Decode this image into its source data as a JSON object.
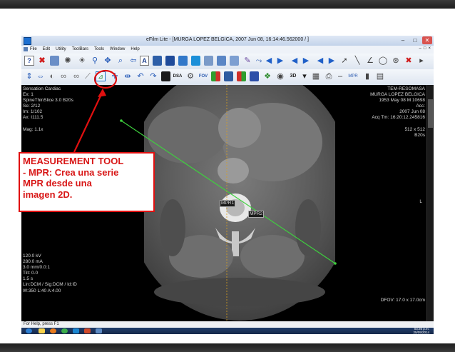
{
  "window": {
    "title": "eFilm Lite - [MURGA LOPEZ BELGICA, 2007 Jun 08, 16:14:46.562000 / ]",
    "controls": [
      "–",
      "□",
      "✕"
    ]
  },
  "menubar": {
    "items": [
      "File",
      "Edit",
      "Utility",
      "ToolBars",
      "Tools",
      "Window",
      "Help"
    ],
    "mdi_controls": [
      "–",
      "□",
      "×"
    ]
  },
  "viewer": {
    "top_left": [
      "Sensation Cardiac",
      "Ex: 1",
      "SpineThinSlice  3.0  B20s",
      "Se: 2/12",
      "Im: 1/102",
      "Ax: I111.5",
      "",
      "Mag: 1.1x"
    ],
    "top_right": [
      "TEM-RESOMASA",
      "MURGA LOPEZ BELGICA",
      "1953 May 08  M  10698",
      "Acc:",
      "2007 Jun 08",
      "Acq Tm: 16:20:12.245816",
      "",
      "512 x 512",
      "B20s"
    ],
    "bottom_left": [
      "120.0 kV",
      "280.0 mA",
      "3.0 mm/0.0:1",
      "Tilt: 0.0",
      "1.5 s",
      "Lin:DCM / Sig:DCM / Id:ID",
      "W:350  L:40  A:4.00"
    ],
    "bottom_right": [
      "DFOV: 17.0 x 17.0cm"
    ],
    "side_left": "R",
    "side_right": "L",
    "mpr_labels": [
      "MPR1",
      "MPR2"
    ],
    "mpr_line_color": "#3ed13e",
    "crosshair_color": "#d9a020"
  },
  "status": {
    "text": "For Help, press F1"
  },
  "taskbar": {
    "time": "03:26 p.m.",
    "date": "25/09/2014"
  },
  "annotation": {
    "text": "MEASUREMENT TOOL\n- MPR: Crea una serie\nMPR desde una\nimagen 2D.",
    "color": "#d81616",
    "border_color": "#e01010"
  },
  "icons": [
    "help-icon",
    "close-x-icon",
    "window-icon",
    "sun-icon",
    "magnify-icon",
    "pan-icon",
    "magnify-plus-icon",
    "arrow-left-icon",
    "text-annotation-icon",
    "mpr-tool-icon",
    "dsa-icon",
    "fov-icon",
    "3d-icon",
    "mpr-icon"
  ]
}
